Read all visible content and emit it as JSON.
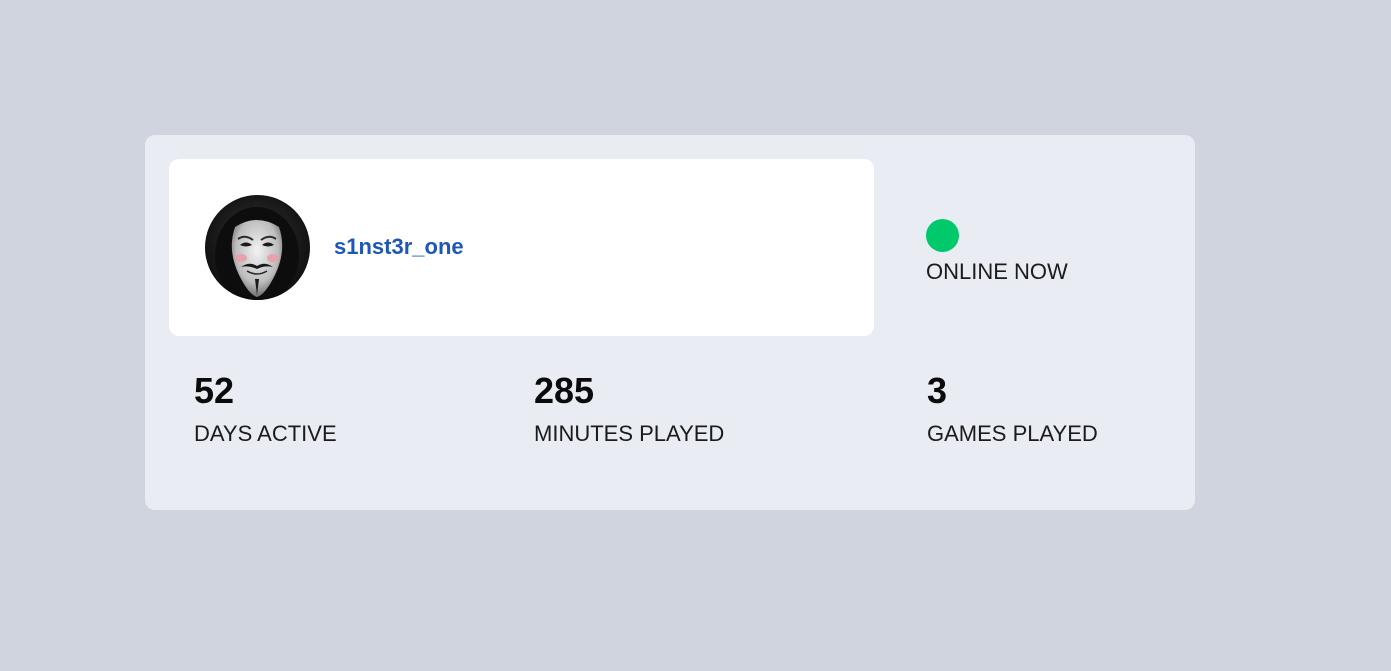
{
  "profile": {
    "username": "s1nst3r_one",
    "avatar_icon": "masked-face-avatar"
  },
  "status": {
    "label": "ONLINE NOW",
    "color": "#00c96b"
  },
  "stats": [
    {
      "value": "52",
      "label": "DAYS ACTIVE"
    },
    {
      "value": "285",
      "label": "MINUTES PLAYED"
    },
    {
      "value": "3",
      "label": "GAMES PLAYED"
    }
  ],
  "colors": {
    "page_background": "#cfd4df",
    "card_background": "#e9ecf3",
    "username": "#1e57b8"
  }
}
